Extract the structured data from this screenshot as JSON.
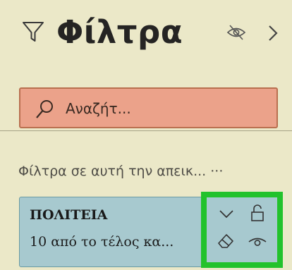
{
  "pane": {
    "title": "Φίλτρα",
    "icons": {
      "filter": "filter-icon",
      "visibility": "eye-off-icon",
      "collapse": "chevron-right-icon"
    }
  },
  "search": {
    "placeholder": "Αναζήτ...",
    "icon": "search-icon"
  },
  "section": {
    "label": "Φίλτρα σε αυτή την απεικ... ···"
  },
  "filter_card": {
    "field": "ΠΟΛΙΤΕΙΑ",
    "summary": "10 από το τέλος κα...",
    "icons": [
      "chevron-down-icon",
      "lock-icon",
      "eraser-icon",
      "eye-icon"
    ]
  },
  "colors": {
    "pane_background": "#ebe8c8",
    "search_background": "#eba28a",
    "search_border": "#b96f4f",
    "card_background": "#a7c9cf",
    "highlight": "#22c22c"
  }
}
